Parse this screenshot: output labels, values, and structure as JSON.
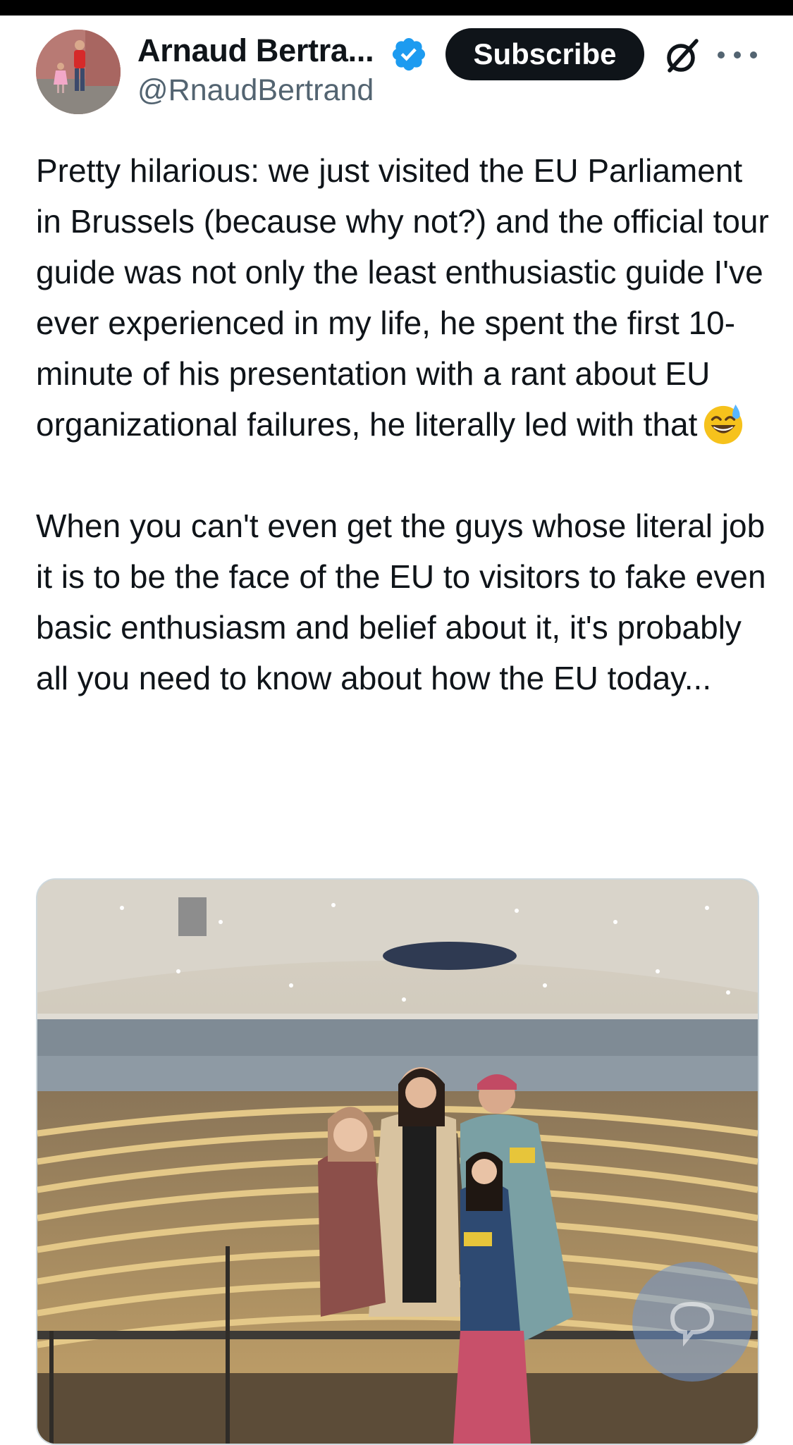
{
  "post": {
    "author": {
      "display_name": "Arnaud Bertra...",
      "handle": "@RnaudBertrand",
      "verified": true
    },
    "subscribe_label": "Subscribe",
    "paragraphs": [
      "Pretty hilarious: we just visited the EU Parliament in Brussels (because why not?) and the official tour guide was not only the least enthusiastic guide I've ever experienced in my life, he spent the first 10-minute of his presentation with a rant about EU organizational failures, he literally led with that",
      "When you can't even get the guys whose literal job it is to be the face of the EU to visitors to fake even basic enthusiasm and belief about it, it's probably all you need to know about how the EU today..."
    ],
    "emoji": "grinning-face-with-sweat"
  },
  "icons": {
    "verified": "verified-badge-icon",
    "grok": "grok-icon",
    "more": "more-horizontal-icon",
    "reply": "reply-bubble-icon"
  },
  "colors": {
    "text": "#0f1419",
    "secondary": "#536471",
    "verified": "#1d9bf0",
    "subscribe_bg": "#0f1419"
  }
}
